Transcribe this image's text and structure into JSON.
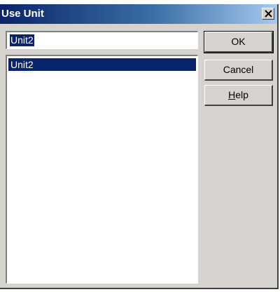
{
  "window": {
    "title": "Use Unit"
  },
  "unit_name_field": {
    "value": "Unit2"
  },
  "unit_list": {
    "items": [
      "Unit2"
    ],
    "selected_index": 0
  },
  "buttons": {
    "ok": "OK",
    "cancel": "Cancel",
    "help_mnemonic": "H",
    "help_rest": "elp"
  },
  "icons": {
    "close": "close-icon"
  },
  "colors": {
    "selection": "#0a246a",
    "titlebar_start": "#0a246a",
    "titlebar_end": "#a6caf0",
    "dialog_face": "#d6d3ce"
  }
}
